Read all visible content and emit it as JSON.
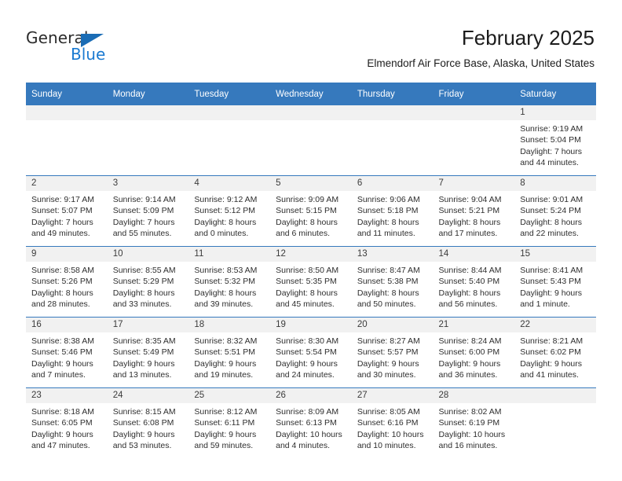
{
  "brand": {
    "name_part1": "General",
    "name_part2": "Blue",
    "triangle_icon": "triangle-icon",
    "accent_color": "#1a7ad1"
  },
  "header": {
    "month_title": "February 2025",
    "location": "Elmendorf Air Force Base, Alaska, United States"
  },
  "calendar": {
    "header_bg": "#3679bd",
    "daynum_band_bg": "#f1f1f1",
    "weekday_headers": [
      "Sunday",
      "Monday",
      "Tuesday",
      "Wednesday",
      "Thursday",
      "Friday",
      "Saturday"
    ],
    "weeks": [
      [
        {
          "day": "",
          "empty": true
        },
        {
          "day": "",
          "empty": true
        },
        {
          "day": "",
          "empty": true
        },
        {
          "day": "",
          "empty": true
        },
        {
          "day": "",
          "empty": true
        },
        {
          "day": "",
          "empty": true
        },
        {
          "day": "1",
          "sunrise": "Sunrise: 9:19 AM",
          "sunset": "Sunset: 5:04 PM",
          "daylight_line1": "Daylight: 7 hours",
          "daylight_line2": "and 44 minutes."
        }
      ],
      [
        {
          "day": "2",
          "sunrise": "Sunrise: 9:17 AM",
          "sunset": "Sunset: 5:07 PM",
          "daylight_line1": "Daylight: 7 hours",
          "daylight_line2": "and 49 minutes."
        },
        {
          "day": "3",
          "sunrise": "Sunrise: 9:14 AM",
          "sunset": "Sunset: 5:09 PM",
          "daylight_line1": "Daylight: 7 hours",
          "daylight_line2": "and 55 minutes."
        },
        {
          "day": "4",
          "sunrise": "Sunrise: 9:12 AM",
          "sunset": "Sunset: 5:12 PM",
          "daylight_line1": "Daylight: 8 hours",
          "daylight_line2": "and 0 minutes."
        },
        {
          "day": "5",
          "sunrise": "Sunrise: 9:09 AM",
          "sunset": "Sunset: 5:15 PM",
          "daylight_line1": "Daylight: 8 hours",
          "daylight_line2": "and 6 minutes."
        },
        {
          "day": "6",
          "sunrise": "Sunrise: 9:06 AM",
          "sunset": "Sunset: 5:18 PM",
          "daylight_line1": "Daylight: 8 hours",
          "daylight_line2": "and 11 minutes."
        },
        {
          "day": "7",
          "sunrise": "Sunrise: 9:04 AM",
          "sunset": "Sunset: 5:21 PM",
          "daylight_line1": "Daylight: 8 hours",
          "daylight_line2": "and 17 minutes."
        },
        {
          "day": "8",
          "sunrise": "Sunrise: 9:01 AM",
          "sunset": "Sunset: 5:24 PM",
          "daylight_line1": "Daylight: 8 hours",
          "daylight_line2": "and 22 minutes."
        }
      ],
      [
        {
          "day": "9",
          "sunrise": "Sunrise: 8:58 AM",
          "sunset": "Sunset: 5:26 PM",
          "daylight_line1": "Daylight: 8 hours",
          "daylight_line2": "and 28 minutes."
        },
        {
          "day": "10",
          "sunrise": "Sunrise: 8:55 AM",
          "sunset": "Sunset: 5:29 PM",
          "daylight_line1": "Daylight: 8 hours",
          "daylight_line2": "and 33 minutes."
        },
        {
          "day": "11",
          "sunrise": "Sunrise: 8:53 AM",
          "sunset": "Sunset: 5:32 PM",
          "daylight_line1": "Daylight: 8 hours",
          "daylight_line2": "and 39 minutes."
        },
        {
          "day": "12",
          "sunrise": "Sunrise: 8:50 AM",
          "sunset": "Sunset: 5:35 PM",
          "daylight_line1": "Daylight: 8 hours",
          "daylight_line2": "and 45 minutes."
        },
        {
          "day": "13",
          "sunrise": "Sunrise: 8:47 AM",
          "sunset": "Sunset: 5:38 PM",
          "daylight_line1": "Daylight: 8 hours",
          "daylight_line2": "and 50 minutes."
        },
        {
          "day": "14",
          "sunrise": "Sunrise: 8:44 AM",
          "sunset": "Sunset: 5:40 PM",
          "daylight_line1": "Daylight: 8 hours",
          "daylight_line2": "and 56 minutes."
        },
        {
          "day": "15",
          "sunrise": "Sunrise: 8:41 AM",
          "sunset": "Sunset: 5:43 PM",
          "daylight_line1": "Daylight: 9 hours",
          "daylight_line2": "and 1 minute."
        }
      ],
      [
        {
          "day": "16",
          "sunrise": "Sunrise: 8:38 AM",
          "sunset": "Sunset: 5:46 PM",
          "daylight_line1": "Daylight: 9 hours",
          "daylight_line2": "and 7 minutes."
        },
        {
          "day": "17",
          "sunrise": "Sunrise: 8:35 AM",
          "sunset": "Sunset: 5:49 PM",
          "daylight_line1": "Daylight: 9 hours",
          "daylight_line2": "and 13 minutes."
        },
        {
          "day": "18",
          "sunrise": "Sunrise: 8:32 AM",
          "sunset": "Sunset: 5:51 PM",
          "daylight_line1": "Daylight: 9 hours",
          "daylight_line2": "and 19 minutes."
        },
        {
          "day": "19",
          "sunrise": "Sunrise: 8:30 AM",
          "sunset": "Sunset: 5:54 PM",
          "daylight_line1": "Daylight: 9 hours",
          "daylight_line2": "and 24 minutes."
        },
        {
          "day": "20",
          "sunrise": "Sunrise: 8:27 AM",
          "sunset": "Sunset: 5:57 PM",
          "daylight_line1": "Daylight: 9 hours",
          "daylight_line2": "and 30 minutes."
        },
        {
          "day": "21",
          "sunrise": "Sunrise: 8:24 AM",
          "sunset": "Sunset: 6:00 PM",
          "daylight_line1": "Daylight: 9 hours",
          "daylight_line2": "and 36 minutes."
        },
        {
          "day": "22",
          "sunrise": "Sunrise: 8:21 AM",
          "sunset": "Sunset: 6:02 PM",
          "daylight_line1": "Daylight: 9 hours",
          "daylight_line2": "and 41 minutes."
        }
      ],
      [
        {
          "day": "23",
          "sunrise": "Sunrise: 8:18 AM",
          "sunset": "Sunset: 6:05 PM",
          "daylight_line1": "Daylight: 9 hours",
          "daylight_line2": "and 47 minutes."
        },
        {
          "day": "24",
          "sunrise": "Sunrise: 8:15 AM",
          "sunset": "Sunset: 6:08 PM",
          "daylight_line1": "Daylight: 9 hours",
          "daylight_line2": "and 53 minutes."
        },
        {
          "day": "25",
          "sunrise": "Sunrise: 8:12 AM",
          "sunset": "Sunset: 6:11 PM",
          "daylight_line1": "Daylight: 9 hours",
          "daylight_line2": "and 59 minutes."
        },
        {
          "day": "26",
          "sunrise": "Sunrise: 8:09 AM",
          "sunset": "Sunset: 6:13 PM",
          "daylight_line1": "Daylight: 10 hours",
          "daylight_line2": "and 4 minutes."
        },
        {
          "day": "27",
          "sunrise": "Sunrise: 8:05 AM",
          "sunset": "Sunset: 6:16 PM",
          "daylight_line1": "Daylight: 10 hours",
          "daylight_line2": "and 10 minutes."
        },
        {
          "day": "28",
          "sunrise": "Sunrise: 8:02 AM",
          "sunset": "Sunset: 6:19 PM",
          "daylight_line1": "Daylight: 10 hours",
          "daylight_line2": "and 16 minutes."
        },
        {
          "day": "",
          "empty": true
        }
      ]
    ]
  }
}
